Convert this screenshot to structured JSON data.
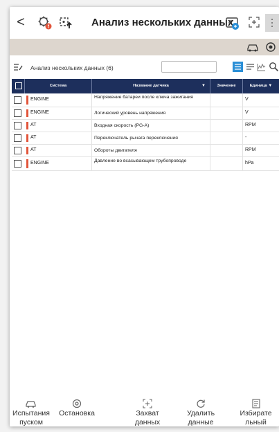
{
  "header": {
    "back_symbol": "<",
    "title": "Анализ нескольких данных",
    "brand_color": "#1d2f5c",
    "accent_color": "#e2543a",
    "band_color": "#ddd6ce"
  },
  "toolbar": {
    "subtitle": "Анализ нескольких данных (6)",
    "filter_placeholder": ""
  },
  "table": {
    "columns": {
      "system": "Система",
      "sensor": "Название датчика",
      "value": "Значение",
      "unit": "Единица"
    },
    "rows": [
      {
        "system": "ENGINE",
        "sensor": "Напряжение батареи после ключа зажигания",
        "value": "",
        "unit": "V"
      },
      {
        "system": "ENGINE",
        "sensor": "Логический уровень напряжения",
        "value": "",
        "unit": "V"
      },
      {
        "system": "AT",
        "sensor": "Входная скорость (PG-A)",
        "value": "",
        "unit": "RPM"
      },
      {
        "system": "AT",
        "sensor": "Переключатель рычага переключения",
        "value": "",
        "unit": "-"
      },
      {
        "system": "AT",
        "sensor": "Обороты двигателя",
        "value": "",
        "unit": "RPM"
      },
      {
        "system": "ENGINE",
        "sensor": "Давление во всасывающем трубопроводе",
        "value": "",
        "unit": "hPa"
      }
    ]
  },
  "bottom_nav": {
    "items": [
      {
        "line1": "Испытания",
        "line2": "пуском"
      },
      {
        "line1": "Остановка",
        "line2": ""
      },
      {
        "line1": "Захват",
        "line2": "данных"
      },
      {
        "line1": "Удалить",
        "line2": "данные"
      },
      {
        "line1": "Избирате",
        "line2": "льный"
      }
    ]
  }
}
